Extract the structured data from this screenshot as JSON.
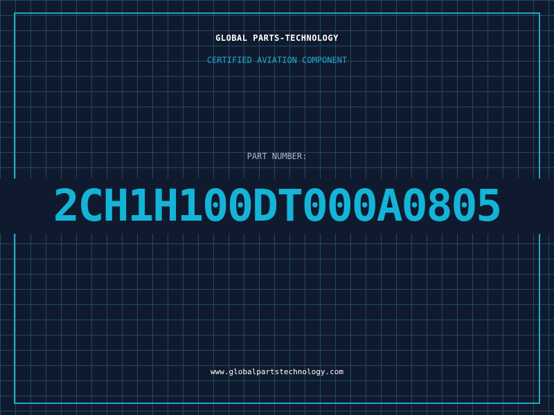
{
  "header": {
    "company_name": "GLOBAL PARTS-TECHNOLOGY",
    "subtitle": "CERTIFIED AVIATION COMPONENT"
  },
  "part": {
    "label": "PART NUMBER:",
    "number": "2CH1H100DT000A0805"
  },
  "footer": {
    "website": "www.globalpartstechnology.com"
  },
  "colors": {
    "background": "#101a2e",
    "grid": "#1f4c61",
    "accent": "#14b4d8",
    "frame": "#22a7c8",
    "title": "#ffffff",
    "label": "#b0b8c4"
  }
}
